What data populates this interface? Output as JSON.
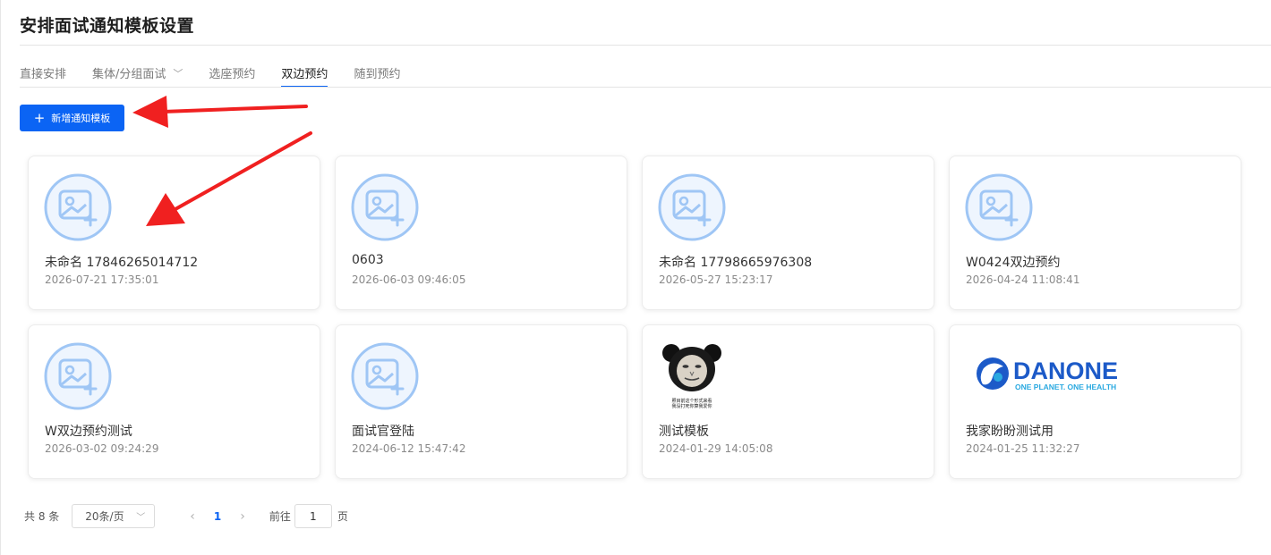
{
  "header": {
    "title": "安排面试通知模板设置"
  },
  "tabs": [
    {
      "label": "直接安排",
      "active": false
    },
    {
      "label": "集体/分组面试",
      "active": false,
      "has_dropdown": true
    },
    {
      "label": "选座预约",
      "active": false
    },
    {
      "label": "双边预约",
      "active": true
    },
    {
      "label": "随到预约",
      "active": false
    }
  ],
  "toolbar": {
    "add_label": "新增通知模板",
    "add_icon": "plus-icon"
  },
  "templates": [
    {
      "name": "未命名 17846265014712",
      "date": "2026-07-21 17:35:01",
      "thumbnail": "image-placeholder-icon"
    },
    {
      "name": "0603",
      "date": "2026-06-03 09:46:05",
      "thumbnail": "image-placeholder-icon"
    },
    {
      "name": "未命名 17798665976308",
      "date": "2026-05-27 15:23:17",
      "thumbnail": "image-placeholder-icon"
    },
    {
      "name": "W0424双边预约",
      "date": "2026-04-24 11:08:41",
      "thumbnail": "image-placeholder-icon"
    },
    {
      "name": "W双边预约测试",
      "date": "2026-03-02 09:24:29",
      "thumbnail": "image-placeholder-icon"
    },
    {
      "name": "面试官登陆",
      "date": "2024-06-12 15:47:42",
      "thumbnail": "image-placeholder-icon"
    },
    {
      "name": "测试模板",
      "date": "2024-01-29 14:05:08",
      "thumbnail": "panda-meme-image",
      "thumbnail_caption": [
        "照目前这个形式来看",
        "我没打死你算我爱你"
      ]
    },
    {
      "name": "我家盼盼测试用",
      "date": "2024-01-25 11:32:27",
      "thumbnail": "danone-logo",
      "logo_text": {
        "brand": "DANONE",
        "slogan": "ONE PLANET. ONE HEALTH"
      }
    }
  ],
  "pagination": {
    "total_label": "共 8 条",
    "page_size_label": "20条/页",
    "current_page": "1",
    "goto_prefix": "前往",
    "goto_value": "1",
    "goto_suffix": "页"
  },
  "colors": {
    "primary": "#0b64f4",
    "placeholder_icon": "#9fc6f5",
    "annotation_arrow": "#f02020",
    "danone_blue": "#1c5ac8"
  },
  "annotations": [
    "red-arrow-to-add-button",
    "red-arrow-to-first-card"
  ]
}
